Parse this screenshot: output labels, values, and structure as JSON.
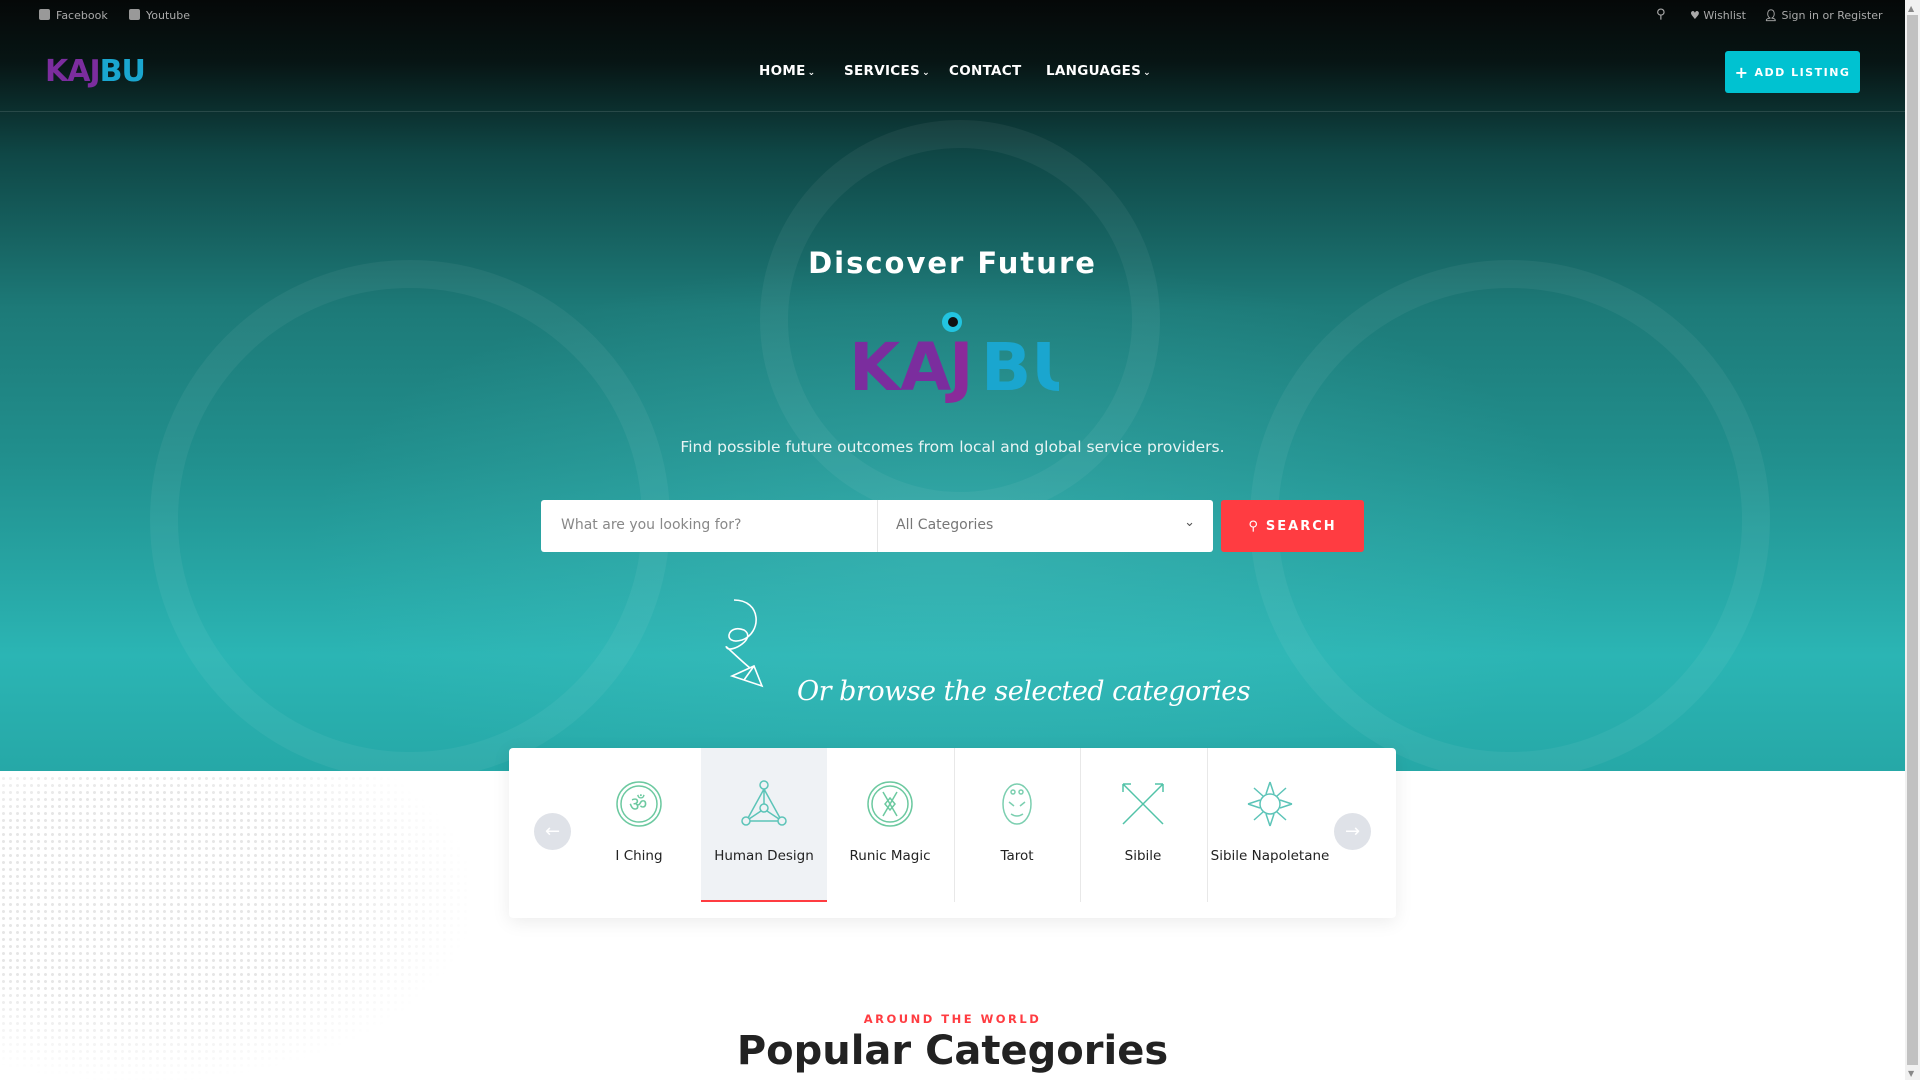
{
  "topbar": {
    "facebook": "Facebook",
    "youtube": "Youtube",
    "wishlist": "Wishlist",
    "signin": "Sign in or Register"
  },
  "brand": {
    "logo": "KAJBU",
    "logo_purple": "#7b2d9e",
    "logo_blue": "#1aa6cf"
  },
  "nav": {
    "items": [
      {
        "label": "HOME"
      },
      {
        "label": "SERVICES"
      },
      {
        "label": "CONTACT"
      },
      {
        "label": "LANGUAGES"
      }
    ],
    "add_listing": "ADD LISTING"
  },
  "hero": {
    "title": "Discover Future",
    "subtitle": "Find possible future outcomes from local and global service providers.",
    "search_placeholder": "What are you looking for?",
    "category_select": "All Categories",
    "search_button": "SEARCH",
    "browse_text": "Or browse the selected categories"
  },
  "categories": [
    {
      "label": "I Ching"
    },
    {
      "label": "Human Design",
      "active": true
    },
    {
      "label": "Runic Magic"
    },
    {
      "label": "Tarot"
    },
    {
      "label": "Sibile"
    },
    {
      "label": "Sibile Napoletane"
    }
  ],
  "section": {
    "kicker": "AROUND THE WORLD",
    "title": "Popular Categories"
  },
  "colors": {
    "accent": "#ff3c41",
    "primary": "#00c2d1"
  }
}
